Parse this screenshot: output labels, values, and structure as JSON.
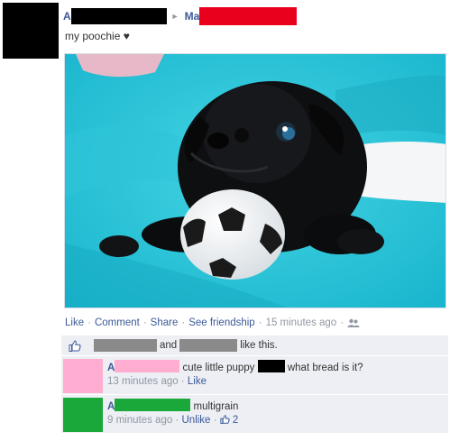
{
  "post": {
    "author_initial": "A",
    "target_initial": "Ma",
    "text": "my poochie ♥"
  },
  "actions": {
    "like": "Like",
    "comment": "Comment",
    "share": "Share",
    "see_friendship": "See friendship",
    "timestamp": "15 minutes ago",
    "dot": "·"
  },
  "likes": {
    "and": "and",
    "suffix": "like this."
  },
  "comments": [
    {
      "initial": "A",
      "text_a": "cute little puppy",
      "text_b": "what bread is it?",
      "time": "13 minutes ago",
      "action": "Like"
    },
    {
      "initial": "A",
      "text_a": "multigrain",
      "time": "9 minutes ago",
      "action": "Unlike",
      "like_count": "2"
    }
  ],
  "colors": {
    "link": "#3b5998",
    "ufi_bg": "#edeff4",
    "redaction_red": "#e8001c",
    "redaction_pink": "#ffadd0",
    "redaction_green": "#1aa83a"
  }
}
